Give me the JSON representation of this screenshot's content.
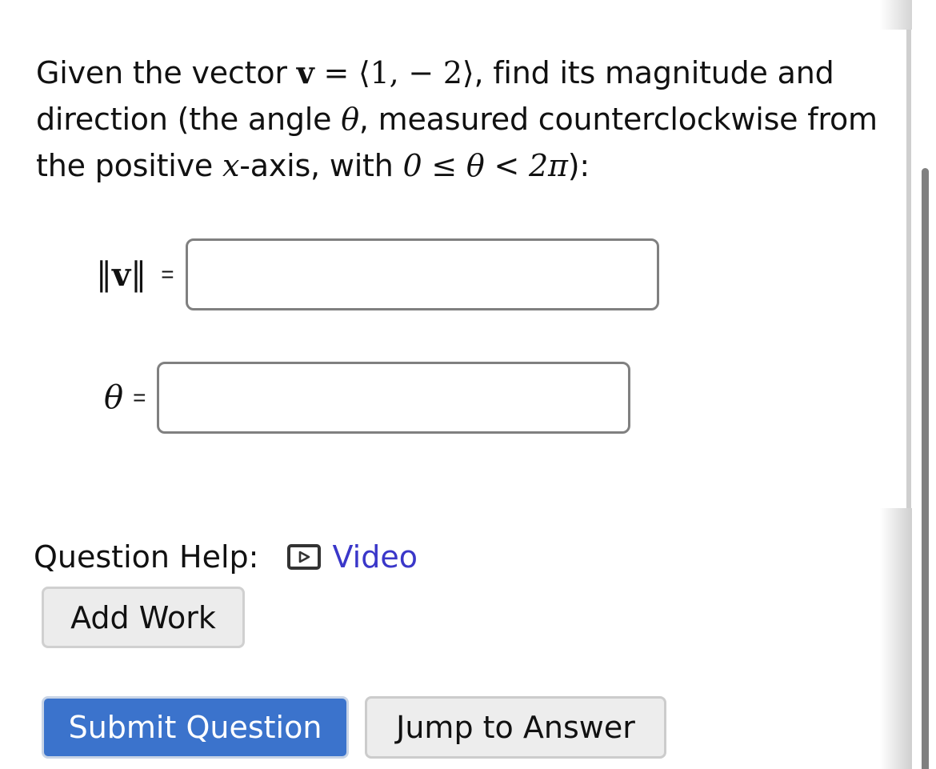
{
  "question": {
    "t1": "Given the vector ",
    "vec_symbol": "v",
    "eq_sign": " = ",
    "vec_value": "⟨1,  − 2⟩",
    "t2": ", find its magnitude and direction (the angle ",
    "theta": "θ",
    "t3": ", measured counterclockwise from the positive ",
    "x": "x",
    "t4": "-axis, with ",
    "range": "0 ≤ θ < 2π",
    "t5": "):"
  },
  "fields": {
    "magnitude": {
      "label_left": "‖",
      "label_symbol": "v",
      "label_right": "‖",
      "equals": "=",
      "value": "",
      "placeholder": ""
    },
    "angle": {
      "label_symbol": "θ",
      "equals": "=",
      "value": "",
      "placeholder": ""
    }
  },
  "help": {
    "label": "Question Help:",
    "video_icon": "play-video-icon",
    "video_label": "Video",
    "link_color": "#3a37c9"
  },
  "buttons": {
    "add_work": "Add Work",
    "submit": "Submit Question",
    "jump": "Jump to Answer",
    "submit_color": "#3b73cc"
  }
}
